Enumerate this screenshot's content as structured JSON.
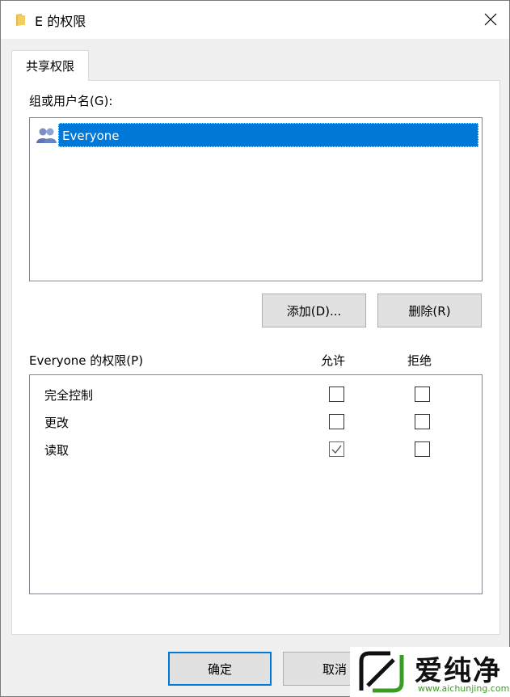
{
  "window": {
    "title": "E 的权限",
    "close_glyph": "✕",
    "folder_icon_color": "#e8b84a"
  },
  "tabs": [
    {
      "label": "共享权限",
      "active": true
    }
  ],
  "groups": {
    "label": "组或用户名(G):",
    "items": [
      {
        "name": "Everyone",
        "icon": "users-icon",
        "selected": true
      }
    ],
    "add_button": "添加(D)...",
    "remove_button": "删除(R)"
  },
  "permissions": {
    "label": "Everyone 的权限(P)",
    "allow_header": "允许",
    "deny_header": "拒绝",
    "rows": [
      {
        "name": "完全控制",
        "allow": false,
        "deny": false
      },
      {
        "name": "更改",
        "allow": false,
        "deny": false
      },
      {
        "name": "读取",
        "allow": true,
        "deny": false
      }
    ]
  },
  "footer": {
    "ok_button": "确定",
    "cancel_button": "取消"
  },
  "watermark": {
    "text": "爱纯净",
    "url": "www.aichunjing.com"
  },
  "colors": {
    "selection": "#0078d7",
    "accent_green": "#3a9d23"
  }
}
